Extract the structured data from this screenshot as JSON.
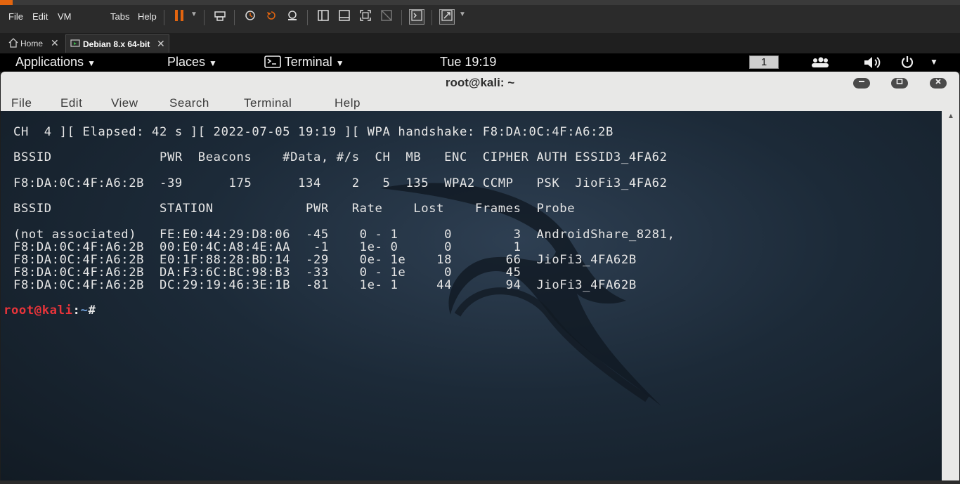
{
  "vmware": {
    "menus": [
      "File",
      "Edit",
      "VM",
      "Tabs",
      "Help"
    ],
    "icons": [
      "pause-icon",
      "dropdown-caret-icon",
      "send-ctrl-alt-del-icon",
      "snapshot-icon",
      "revert-snapshot-icon",
      "snapshot-manager-icon",
      "single-pane-icon",
      "thumbnail-bar-icon",
      "fullscreen-icon",
      "unity-icon",
      "console-view-icon",
      "stretch-icon"
    ],
    "tabs": [
      {
        "label": "Home"
      },
      {
        "label": "Debian 8.x 64-bit"
      }
    ]
  },
  "gnome": {
    "applications": "Applications",
    "places": "Places",
    "terminal": "Terminal",
    "clock": "Tue 19:19",
    "workspace": "1"
  },
  "terminal": {
    "title": "root@kali: ~",
    "menu": [
      "File",
      "Edit",
      "View",
      "Search",
      "Terminal",
      "Help"
    ],
    "lines": [
      "CH  4 ][ Elapsed: 42 s ][ 2022-07-05 19:19 ][ WPA handshake: F8:DA:0C:4F:A6:2B",
      "BSSID              PWR  Beacons    #Data, #/s  CH  MB   ENC  CIPHER AUTH ESSID3_4FA62",
      "F8:DA:0C:4F:A6:2B  -39      175      134    2   5  135  WPA2 CCMP   PSK  JioFi3_4FA62",
      "BSSID              STATION            PWR   Rate    Lost    Frames  Probe",
      "(not associated)   FE:E0:44:29:D8:06  -45    0 - 1      0        3  AndroidShare_8281,",
      "F8:DA:0C:4F:A6:2B  00:E0:4C:A8:4E:AA   -1    1e- 0      0        1",
      "F8:DA:0C:4F:A6:2B  E0:1F:88:28:BD:14  -29    0e- 1e    18       66  JioFi3_4FA62B",
      "F8:DA:0C:4F:A6:2B  DA:F3:6C:BC:98:B3  -33    0 - 1e     0       45",
      "F8:DA:0C:4F:A6:2B  DC:29:19:46:3E:1B  -81    1e- 1     44       94  JioFi3_4FA62B"
    ],
    "prompt_user": "root@kali",
    "prompt_sep": ":",
    "prompt_path": "~",
    "prompt_char": "#"
  },
  "colors": {
    "prompt_user": "#e8343a",
    "prompt_path": "#6f9fd8",
    "accent_orange": "#e3650f"
  }
}
